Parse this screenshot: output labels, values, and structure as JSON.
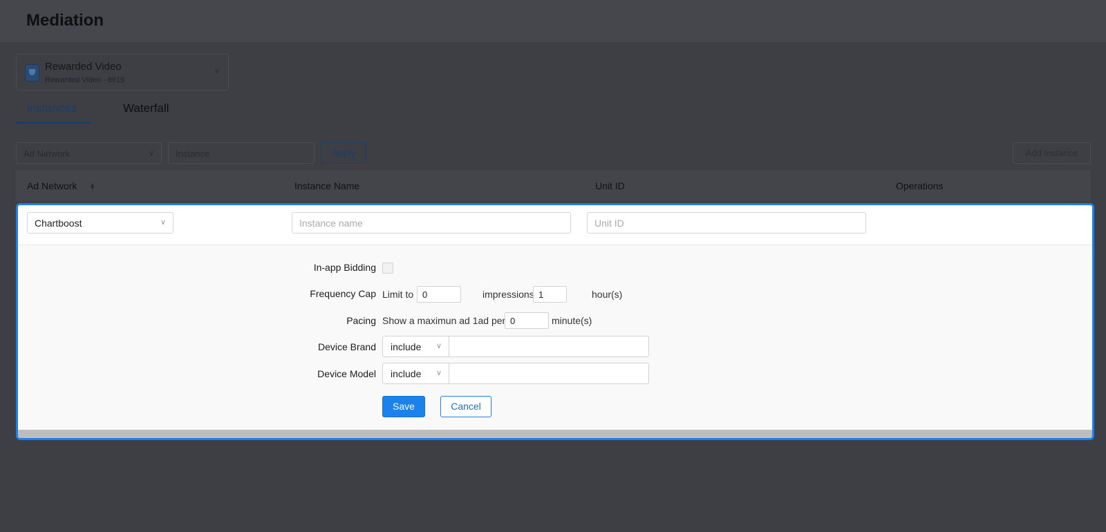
{
  "header": {
    "title": "Mediation"
  },
  "app_selector": {
    "name": "Rewarded Video",
    "subtitle": "Rewarded Video · 8619"
  },
  "tabs": [
    {
      "label": "Instances",
      "active": true
    },
    {
      "label": "Waterfall",
      "active": false
    }
  ],
  "filters": {
    "network_placeholder": "Ad Network",
    "instance_placeholder": "Instance",
    "apply_label": "Apply",
    "add_instance_label": "Add Instance"
  },
  "table": {
    "columns": [
      "Ad Network",
      "Instance Name",
      "Unit ID",
      "Operations"
    ]
  },
  "edit_row": {
    "network": "Chartboost",
    "instance_placeholder": "Instance name",
    "unit_placeholder": "Unit ID"
  },
  "form": {
    "bidding_label": "In-app Bidding",
    "bidding_checked": false,
    "freq_label": "Frequency Cap",
    "limit_to": "Limit to",
    "impressions_value": "0",
    "impressions_per": "impressions per",
    "hours_value": "1",
    "hours_unit": "hour(s)",
    "pacing_label": "Pacing",
    "pacing_text": "Show a maximun ad 1ad per",
    "minutes_value": "0",
    "minutes_unit": "minute(s)",
    "brand_label": "Device Brand",
    "brand_mode": "include",
    "brand_value": "",
    "model_label": "Device Model",
    "model_mode": "include",
    "model_value": "",
    "save_label": "Save",
    "cancel_label": "Cancel"
  },
  "colors": {
    "accent": "#1b82ec",
    "overlay_background": "#3d3f44",
    "panel_border": "#1a7ff0"
  }
}
